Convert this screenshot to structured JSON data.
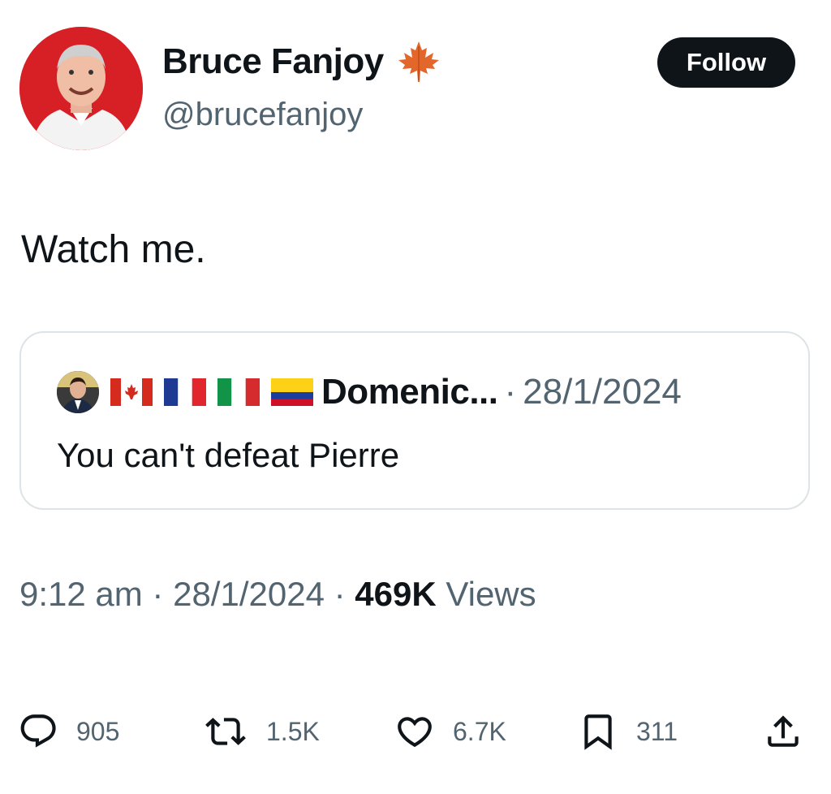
{
  "author": {
    "display_name": "Bruce Fanjoy",
    "handle": "@brucefanjoy",
    "badge_icon": "maple-leaf-icon",
    "avatar_bg": "#d71f26"
  },
  "follow_button": {
    "label": "Follow"
  },
  "tweet": {
    "text": "Watch me."
  },
  "quoted_tweet": {
    "name": "Domenic...",
    "flags": [
      "canada-flag-icon",
      "france-flag-icon",
      "italy-flag-icon",
      "colombia-flag-icon"
    ],
    "separator": "·",
    "date": "28/1/2024",
    "text": "You can't defeat Pierre"
  },
  "meta": {
    "time": "9:12 am",
    "sep1": " · ",
    "date": "28/1/2024",
    "sep2": " · ",
    "views_count": "469K",
    "views_label": " Views"
  },
  "actions": {
    "replies": "905",
    "reposts": "1.5K",
    "likes": "6.7K",
    "bookmarks": "311"
  },
  "colors": {
    "text": "#0f1419",
    "secondary": "#536471",
    "border": "#dde3e7",
    "button": "#0f1419"
  }
}
